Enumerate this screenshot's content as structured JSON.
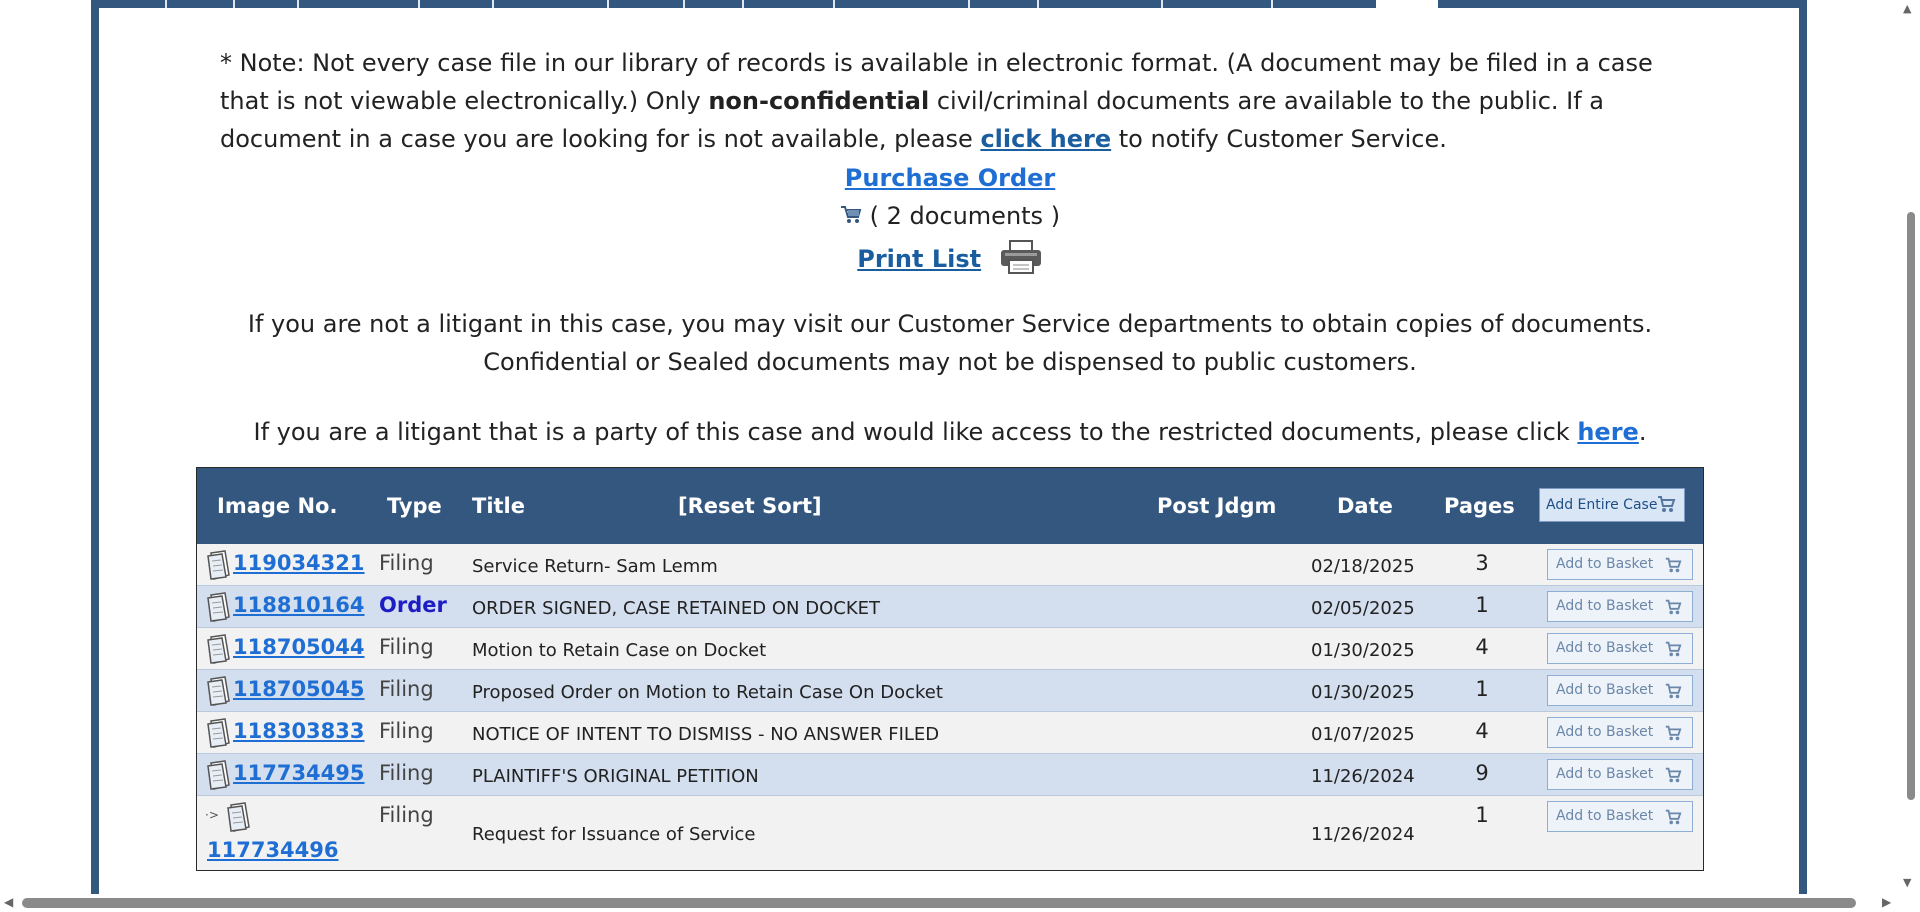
{
  "note": {
    "part1": "* Note: Not every case file in our library of records is available in electronic format. (A document may be filed in a case that is not viewable electronically.) Only ",
    "bold": "non-confidential",
    "part2": " civil/criminal documents are available to the public. If a document in a case you are looking for is not available, please ",
    "link": "click here",
    "part3": " to notify Customer Service."
  },
  "purchase_order": "Purchase Order",
  "doc_count": "( 2 documents )",
  "print_list": "Print List",
  "litigant_text": "If you are not a litigant in this case, you may visit our Customer Service departments to obtain copies of documents. Confidential or Sealed documents may not be dispensed to public customers.",
  "party_text": {
    "before": "If you are a litigant that is a party of this case and would like access to the restricted documents, please click ",
    "link": "here",
    "after": "."
  },
  "table": {
    "headers": {
      "image_no": "Image No.",
      "type": "Type",
      "title": "Title",
      "reset_sort": "[Reset Sort]",
      "post_jdgm": "Post Jdgm",
      "date": "Date",
      "pages": "Pages",
      "add_entire_case": "Add Entire Case"
    },
    "add_to_basket": "Add to Basket",
    "rows": [
      {
        "image_no": "119034321",
        "type": "Filing",
        "title": "Service Return- Sam Lemm",
        "date": "02/18/2025",
        "pages": "3"
      },
      {
        "image_no": "118810164",
        "type": "Order",
        "title": "ORDER SIGNED, CASE RETAINED ON DOCKET",
        "date": "02/05/2025",
        "pages": "1"
      },
      {
        "image_no": "118705044",
        "type": "Filing",
        "title": "Motion to Retain Case on Docket",
        "date": "01/30/2025",
        "pages": "4"
      },
      {
        "image_no": "118705045",
        "type": "Filing",
        "title": "Proposed Order on Motion to Retain Case On Docket",
        "date": "01/30/2025",
        "pages": "1"
      },
      {
        "image_no": "118303833",
        "type": "Filing",
        "title": "NOTICE OF INTENT TO DISMISS - NO ANSWER FILED",
        "date": "01/07/2025",
        "pages": "4"
      },
      {
        "image_no": "117734495",
        "type": "Filing",
        "title": "PLAINTIFF'S ORIGINAL PETITION",
        "date": "11/26/2024",
        "pages": "9"
      },
      {
        "image_no": "117734496",
        "type": "Filing",
        "title": "Request for Issuance of Service",
        "date": "11/26/2024",
        "pages": "1"
      }
    ]
  },
  "icons": {
    "document": "document-icon",
    "cart": "shopping-cart-icon",
    "printer": "printer-icon"
  },
  "colors": {
    "header_blue": "#34577f",
    "link_blue": "#1f6ed4",
    "row_alt": "#d3deee",
    "order_type": "#1d1dc4"
  }
}
